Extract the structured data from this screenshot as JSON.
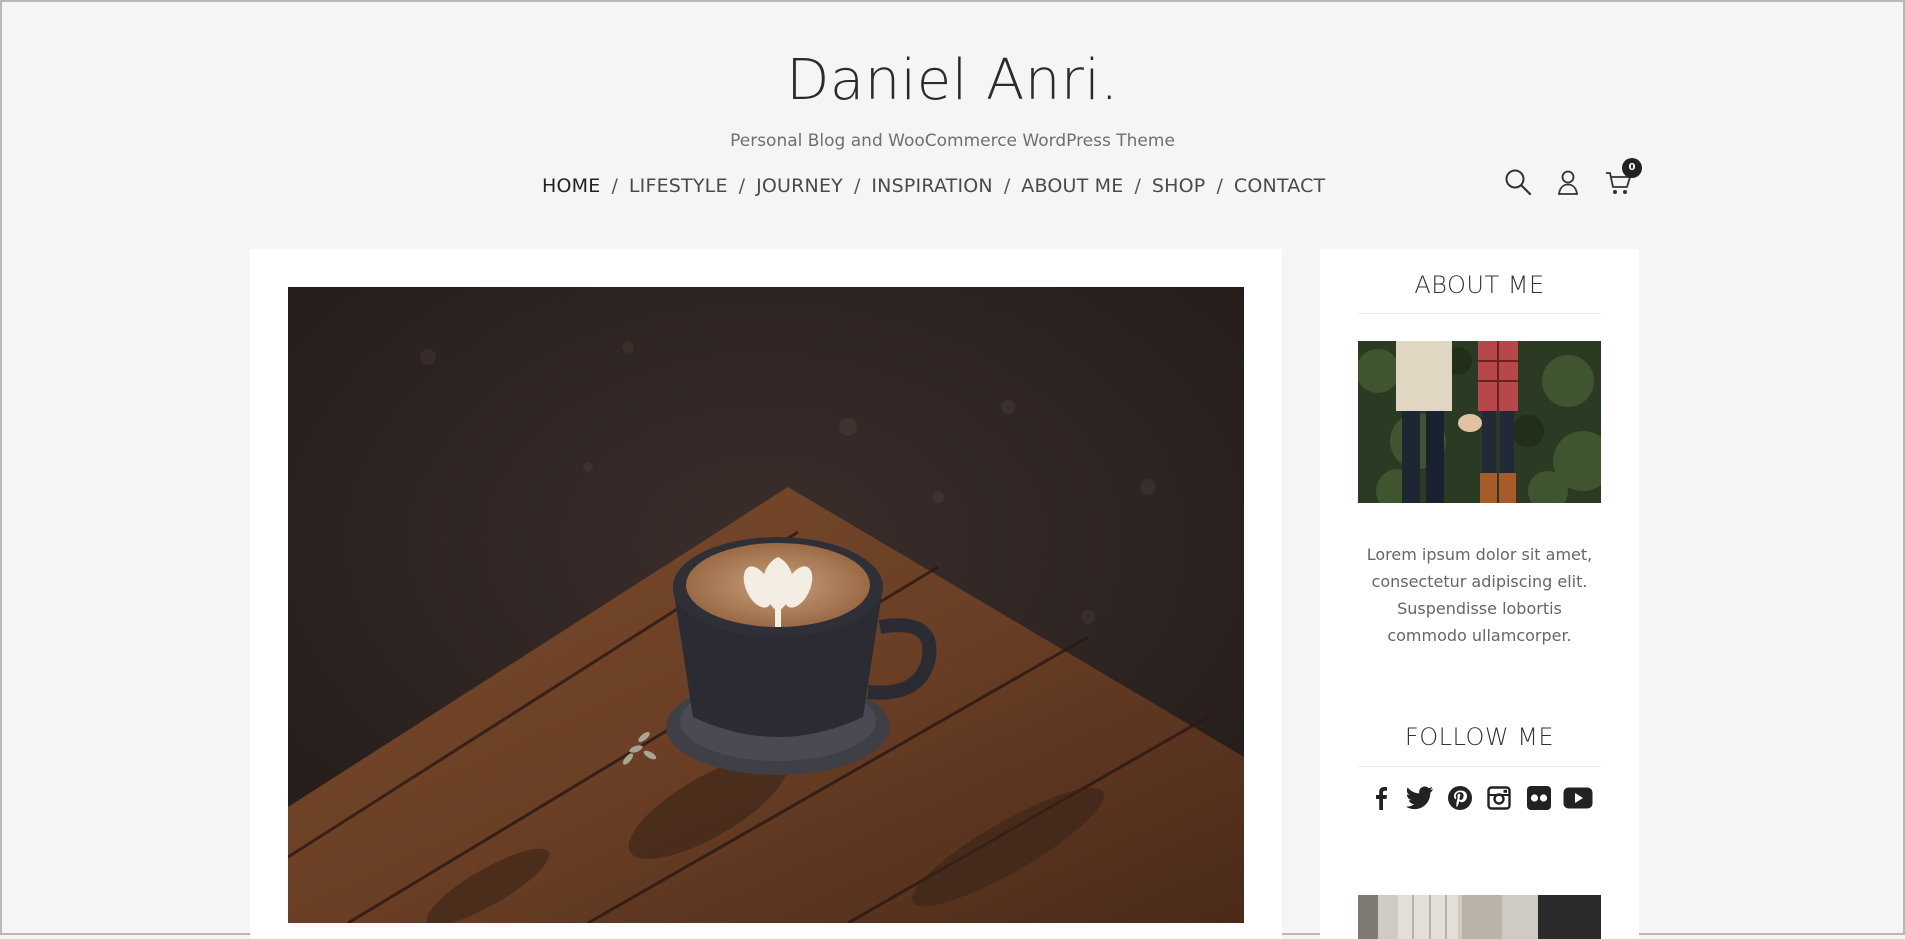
{
  "site": {
    "title": "Daniel Anri.",
    "tagline": "Personal Blog and WooCommerce WordPress Theme"
  },
  "nav": {
    "items": [
      {
        "label": "HOME",
        "active": true
      },
      {
        "label": "LIFESTYLE"
      },
      {
        "label": "JOURNEY"
      },
      {
        "label": "INSPIRATION"
      },
      {
        "label": "ABOUT ME"
      },
      {
        "label": "SHOP"
      },
      {
        "label": "CONTACT"
      }
    ],
    "separator": "/"
  },
  "header_icons": {
    "search": "search-icon",
    "account": "user-icon",
    "cart": "cart-icon",
    "cart_count": "0"
  },
  "main": {
    "featured_image": "latte-art-coffee-cup-on-wooden-table"
  },
  "sidebar": {
    "about": {
      "title": "ABOUT ME",
      "image": "couple-holding-hands-photo",
      "text": "Lorem ipsum dolor sit amet, consectetur adipiscing elit. Suspendisse lobortis commodo ullamcorper."
    },
    "follow": {
      "title": "FOLLOW ME",
      "icons": [
        "facebook-icon",
        "twitter-icon",
        "pinterest-icon",
        "instagram-icon",
        "flickr-icon",
        "youtube-icon"
      ]
    }
  },
  "colors": {
    "background": "#f5f5f5",
    "card": "#ffffff",
    "text": "#333333",
    "muted": "#6f6f6f"
  }
}
